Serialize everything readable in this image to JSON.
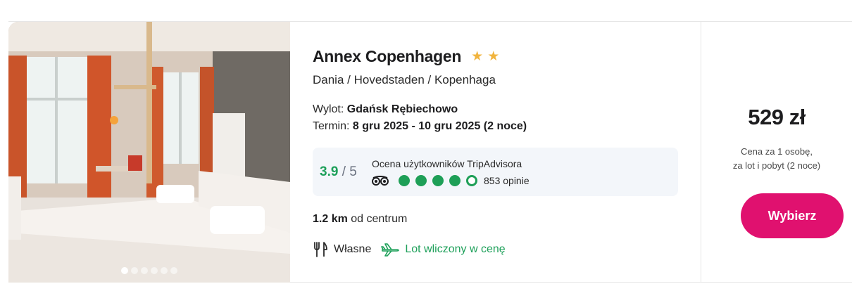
{
  "hotel": {
    "name": "Annex Copenhagen",
    "stars": 2,
    "location": "Dania / Hovedstaden / Kopenhaga"
  },
  "trip": {
    "departure_label": "Wylot:",
    "departure_value": "Gdańsk Rębiechowo",
    "term_label": "Termin:",
    "term_value": "8 gru 2025 - 10 gru 2025 (2 noce)"
  },
  "tripadvisor": {
    "score": "3.9",
    "max": "/ 5",
    "label": "Ocena użytkowników TripAdvisora",
    "bubbles_filled": 4,
    "bubbles_total": 5,
    "reviews": "853 opinie",
    "icon": "tripadvisor-owl-icon"
  },
  "distance": {
    "value": "1.2 km",
    "suffix": "od centrum"
  },
  "features": {
    "board": "Własne",
    "board_icon": "fork-knife-icon",
    "flight": "Lot wliczony w cenę",
    "flight_icon": "airplane-icon"
  },
  "price": {
    "amount": "529 zł",
    "note_line1": "Cena za 1 osobę,",
    "note_line2": "za lot i pobyt (2 noce)",
    "button": "Wybierz"
  },
  "gallery": {
    "dots_total": 6,
    "active_index": 0
  },
  "colors": {
    "accent": "#e0116f",
    "star": "#f1b43e",
    "green": "#1ea05a"
  }
}
